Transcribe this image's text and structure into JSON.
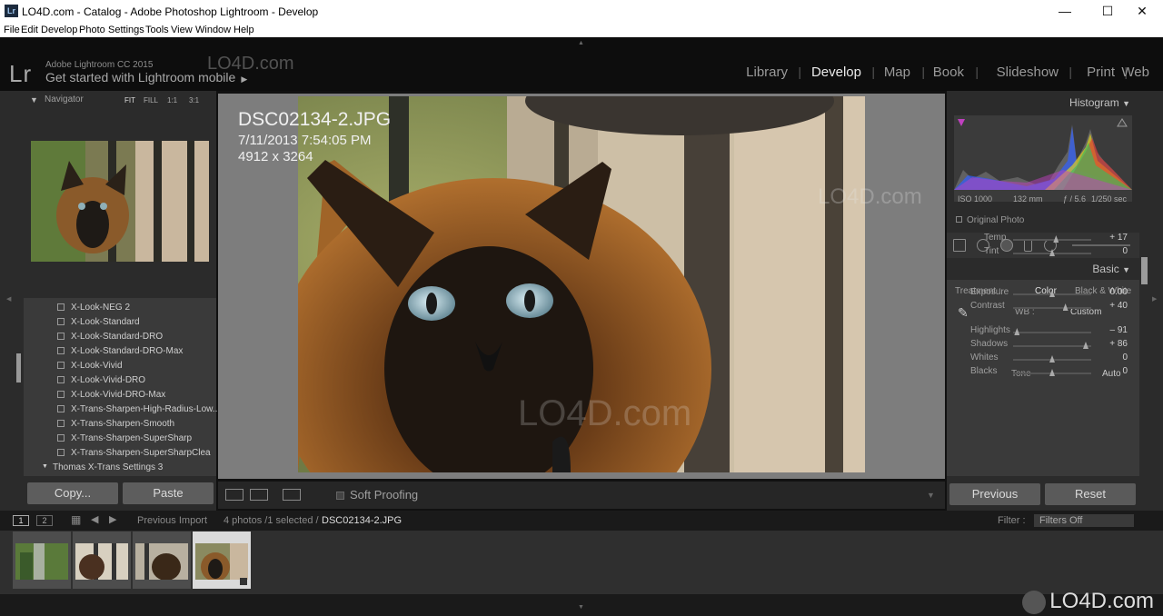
{
  "window": {
    "title": "LO4D.com - Catalog - Adobe Photoshop Lightroom - Develop",
    "app_icon": "Lr",
    "controls": [
      "—",
      "☐",
      "✕"
    ]
  },
  "menu": [
    "File",
    "Edit",
    "Develop",
    "Photo",
    "Settings",
    "Tools",
    "View",
    "Window",
    "Help"
  ],
  "identity": {
    "logo": "Lr",
    "product": "Adobe Lightroom CC 2015",
    "get_started": "Get started with Lightroom mobile",
    "arrow": "▶",
    "watermark": "LO4D.com"
  },
  "modules": [
    "Library",
    "Develop",
    "Map",
    "Book",
    "Slideshow",
    "Print",
    "Web"
  ],
  "navigator": {
    "title": "Navigator",
    "zoom_options": [
      "FIT",
      "FILL",
      "1:1",
      "3:1"
    ]
  },
  "presets": {
    "items": [
      "X-Look-NEG 2",
      "X-Look-Standard",
      "X-Look-Standard-DRO",
      "X-Look-Standard-DRO-Max",
      "X-Look-Vivid",
      "X-Look-Vivid-DRO",
      "X-Look-Vivid-DRO-Max",
      "X-Trans-Sharpen-High-Radius-Low...",
      "X-Trans-Sharpen-Smooth",
      "X-Trans-Sharpen-SuperSharp",
      "X-Trans-Sharpen-SuperSharpClea"
    ],
    "folder": "Thomas X-Trans Settings 3"
  },
  "left_buttons": {
    "copy": "Copy...",
    "paste": "Paste"
  },
  "photo_info": {
    "filename": "DSC02134-2.JPG",
    "date": "7/11/2013 7:54:05 PM",
    "dimensions": "4912 x 3264"
  },
  "toolbar": {
    "soft_proofing": "Soft Proofing"
  },
  "histogram": {
    "title": "Histogram",
    "iso": "ISO 1000",
    "focal": "132 mm",
    "aperture": "ƒ / 5.6",
    "shutter": "1/250 sec",
    "original_photo": "Original Photo"
  },
  "basic": {
    "title": "Basic",
    "treatment_label": "Treatment :",
    "color": "Color",
    "bw": "Black & White",
    "wb_label": "WB :",
    "wb_value": "Custom",
    "tone": "Tone",
    "auto": "Auto",
    "sliders": [
      {
        "label": "Temp",
        "value": "+ 17",
        "pos": 0.55
      },
      {
        "label": "Tint",
        "value": "0",
        "pos": 0.5
      },
      {
        "label": "Exposure",
        "value": "0.00",
        "pos": 0.5
      },
      {
        "label": "Contrast",
        "value": "+ 40",
        "pos": 0.67
      },
      {
        "label": "Highlights",
        "value": "– 91",
        "pos": 0.05
      },
      {
        "label": "Shadows",
        "value": "+ 86",
        "pos": 0.93
      },
      {
        "label": "Whites",
        "value": "0",
        "pos": 0.5
      },
      {
        "label": "Blacks",
        "value": "0",
        "pos": 0.5
      }
    ]
  },
  "right_buttons": {
    "previous": "Previous",
    "reset": "Reset"
  },
  "filmstrip_bar": {
    "screen1": "1",
    "screen2": "2",
    "source": "Previous Import",
    "count": "4 photos /1 selected /",
    "current": "DSC02134-2.JPG",
    "filter_label": "Filter :",
    "filter_value": "Filters Off"
  },
  "watermark_bottom": "LO4D.com"
}
